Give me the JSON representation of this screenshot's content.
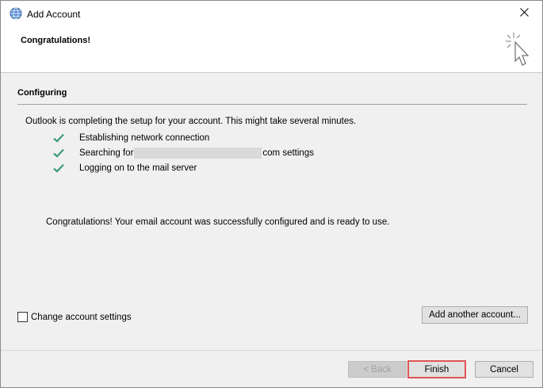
{
  "window": {
    "title": "Add Account",
    "close_icon": "close-icon",
    "app_icon": "outlook-globe-icon"
  },
  "header": {
    "title": "Congratulations!",
    "icon": "wizard-sparkle-cursor-icon"
  },
  "section": {
    "title": "Configuring"
  },
  "intro": "Outlook is completing the setup for your account. This might take several minutes.",
  "steps": [
    {
      "label": "Establishing network connection",
      "status": "done"
    },
    {
      "label_before": "Searching for",
      "label_after": "com settings",
      "status": "done"
    },
    {
      "label": "Logging on to the mail server",
      "status": "done"
    }
  ],
  "success_message": "Congratulations! Your email account was successfully configured and is ready to use.",
  "change_settings": {
    "label": "Change account settings",
    "checked": false
  },
  "buttons": {
    "add_another": "Add another account...",
    "back": "< Back",
    "finish": "Finish",
    "cancel": "Cancel"
  },
  "colors": {
    "check": "#3a9a7a",
    "finish_highlight": "#e05555"
  }
}
